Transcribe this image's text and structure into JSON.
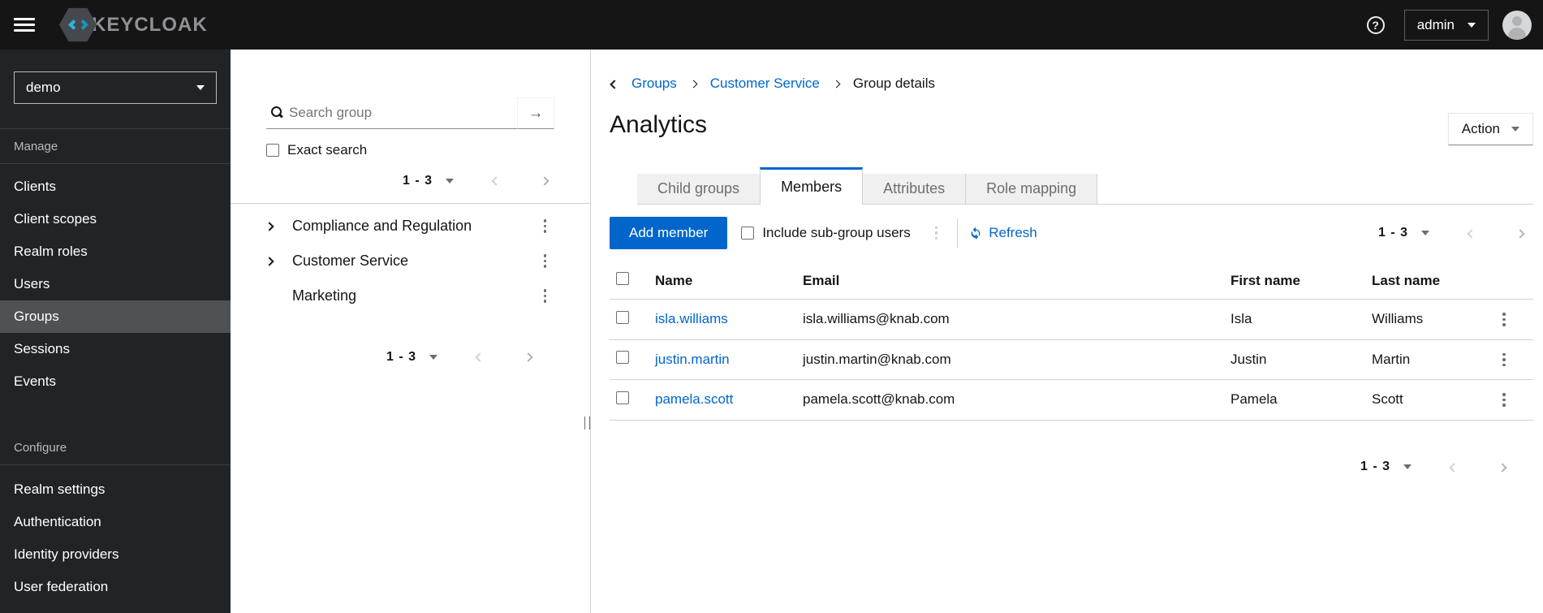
{
  "masthead": {
    "brand": "KEYCLOAK",
    "username": "admin"
  },
  "sidebar": {
    "realm": "demo",
    "sections": [
      {
        "title": "Manage",
        "items": [
          {
            "label": "Clients",
            "active": false
          },
          {
            "label": "Client scopes",
            "active": false
          },
          {
            "label": "Realm roles",
            "active": false
          },
          {
            "label": "Users",
            "active": false
          },
          {
            "label": "Groups",
            "active": true
          },
          {
            "label": "Sessions",
            "active": false
          },
          {
            "label": "Events",
            "active": false
          }
        ]
      },
      {
        "title": "Configure",
        "items": [
          {
            "label": "Realm settings",
            "active": false
          },
          {
            "label": "Authentication",
            "active": false
          },
          {
            "label": "Identity providers",
            "active": false
          },
          {
            "label": "User federation",
            "active": false
          }
        ]
      }
    ]
  },
  "tree_panel": {
    "search_placeholder": "Search group",
    "exact_search_label": "Exact search",
    "pagination_top": {
      "range": "1 - 3"
    },
    "pagination_bottom": {
      "range": "1 - 3"
    },
    "groups": [
      {
        "name": "Compliance and Regulation",
        "expandable": true
      },
      {
        "name": "Customer Service",
        "expandable": true
      },
      {
        "name": "Marketing",
        "expandable": false
      }
    ]
  },
  "main": {
    "breadcrumb": {
      "items": [
        {
          "label": "Groups",
          "link": true
        },
        {
          "label": "Customer Service",
          "link": true
        },
        {
          "label": "Group details",
          "link": false
        }
      ]
    },
    "title": "Analytics",
    "action_button_label": "Action",
    "tabs": [
      {
        "label": "Child groups",
        "active": false
      },
      {
        "label": "Members",
        "active": true
      },
      {
        "label": "Attributes",
        "active": false
      },
      {
        "label": "Role mapping",
        "active": false
      }
    ],
    "toolbar": {
      "add_member_label": "Add member",
      "include_subgroups_label": "Include sub-group users",
      "refresh_label": "Refresh",
      "pagination": {
        "range": "1 - 3"
      }
    },
    "table": {
      "headers": {
        "name": "Name",
        "email": "Email",
        "first_name": "First name",
        "last_name": "Last name"
      },
      "rows": [
        {
          "name": "isla.williams",
          "email": "isla.williams@knab.com",
          "first_name": "Isla",
          "last_name": "Williams"
        },
        {
          "name": "justin.martin",
          "email": "justin.martin@knab.com",
          "first_name": "Justin",
          "last_name": "Martin"
        },
        {
          "name": "pamela.scott",
          "email": "pamela.scott@knab.com",
          "first_name": "Pamela",
          "last_name": "Scott"
        }
      ]
    },
    "pagination_bottom": {
      "range": "1 - 3"
    }
  },
  "icons": {
    "help_glyph": "?",
    "search_arrow_glyph": "→"
  },
  "colors": {
    "accent": "#0066cc",
    "link": "#0066cc",
    "masthead_bg": "#151515",
    "sidebar_bg": "#212427",
    "sidebar_selected_bg": "#4f5255",
    "border": "#d2d2d2",
    "tab_inactive_bg": "#f0f0f0",
    "text": "#151515",
    "muted": "#6a6e73",
    "brand_cyan": "#2db3dd"
  }
}
